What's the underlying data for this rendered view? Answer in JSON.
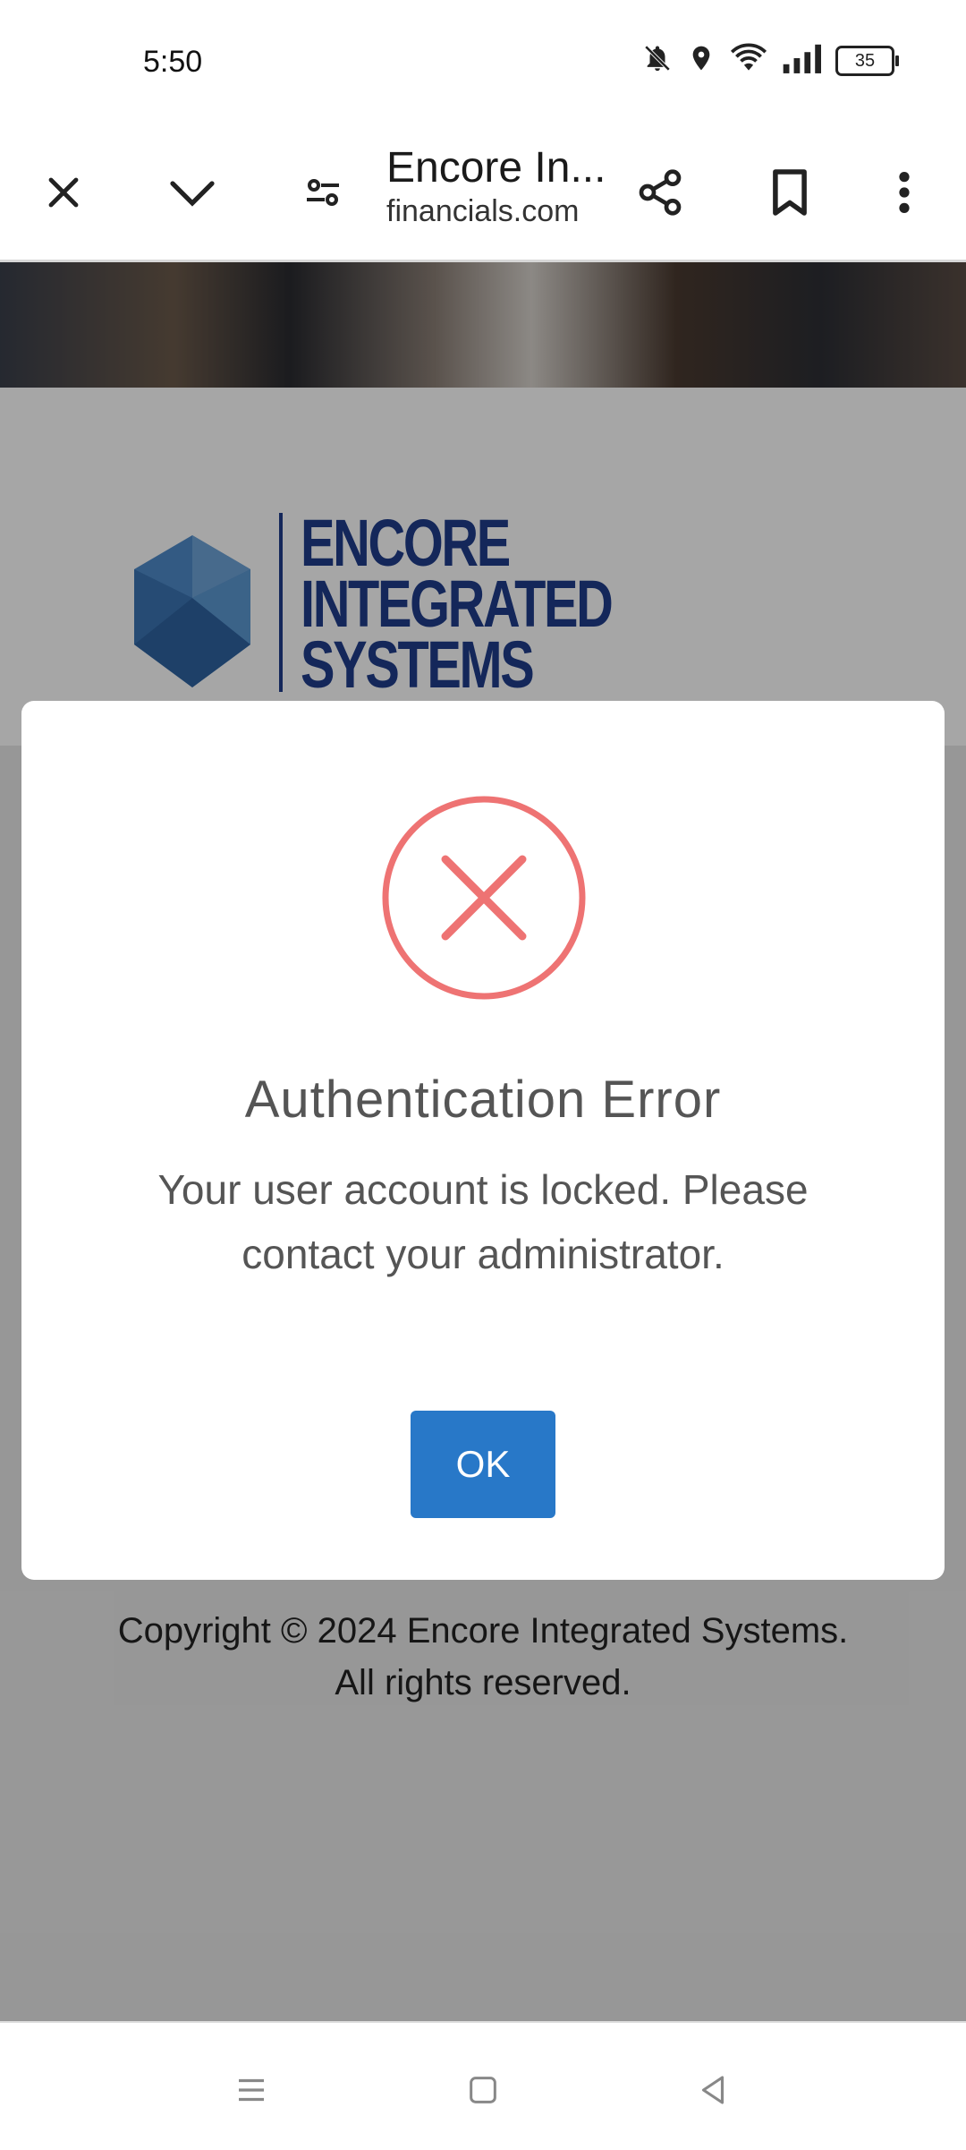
{
  "status_bar": {
    "time": "5:50",
    "battery": "35",
    "icons": [
      "bell-off-icon",
      "location-icon",
      "wifi-icon",
      "signal-icon",
      "battery-icon"
    ]
  },
  "browser": {
    "page_title": "Encore In...",
    "url": "financials.com",
    "icons": [
      "close-icon",
      "chevron-down-icon",
      "site-settings-icon",
      "share-icon",
      "bookmark-icon",
      "more-vert-icon"
    ]
  },
  "page": {
    "logo_lines": [
      "ENCORE",
      "INTEGRATED",
      "SYSTEMS"
    ],
    "copyright_line1": "Copyright © 2024 Encore Integrated Systems.",
    "copyright_line2": "All rights reserved."
  },
  "dialog": {
    "title": "Authentication Error",
    "message": "Your user account is locked. Please contact your administrator.",
    "ok_label": "OK",
    "icon": "error-x-circle-icon"
  },
  "nav": {
    "icons": [
      "recents-icon",
      "home-icon",
      "back-icon"
    ]
  },
  "colors": {
    "error": "#ee7373",
    "button": "#2878c8",
    "brand": "#1f3d8a"
  }
}
